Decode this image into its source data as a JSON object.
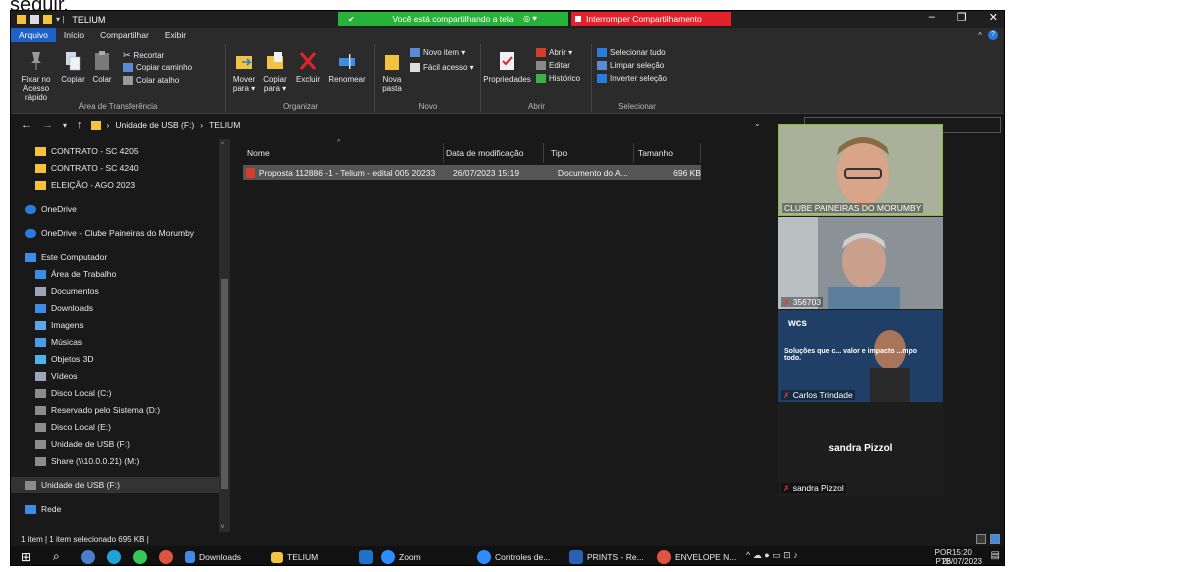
{
  "doc_fragment": "seguir.",
  "window": {
    "title": "TELIUM",
    "share_banner": "Você está compartilhando a tela",
    "stop_share": "Interromper Compartilhamento"
  },
  "ribbon_tabs": [
    {
      "label": "Arquivo",
      "active": true
    },
    {
      "label": "Início",
      "active": false
    },
    {
      "label": "Compartilhar",
      "active": false
    },
    {
      "label": "Exibir",
      "active": false
    }
  ],
  "ribbon": {
    "clipboard": {
      "label": "Área de Transferência",
      "pin_label": "Fixar no Acesso rápido",
      "copy_label": "Copiar",
      "paste_label": "Colar",
      "cut_label": "Recortar",
      "copy_path_label": "Copiar caminho",
      "paste_shortcut_label": "Colar atalho"
    },
    "organize": {
      "label": "Organizar",
      "move_label": "Mover para ▾",
      "copy_to_label": "Copiar para ▾",
      "delete_label": "Excluir",
      "rename_label": "Renomear"
    },
    "new": {
      "label": "Novo",
      "new_folder_label": "Nova pasta",
      "new_item_label": "Novo item ▾",
      "easy_access_label": "Fácil acesso ▾"
    },
    "open": {
      "label": "Abrir",
      "properties_label": "Propriedades",
      "open_label": "Abrir ▾",
      "edit_label": "Editar",
      "history_label": "Histórico"
    },
    "select": {
      "label": "Selecionar",
      "select_all_label": "Selecionar tudo",
      "clear_selection_label": "Limpar seleção",
      "invert_selection_label": "Inverter seleção"
    }
  },
  "address": {
    "crumbs": [
      "Unidade de USB (F:)",
      "TELIUM"
    ],
    "separator": "›"
  },
  "nav_items": [
    {
      "label": "CONTRATO - SC 4205",
      "icon": "folder-icon",
      "color": "#f3c33d"
    },
    {
      "label": "CONTRATO - SC 4240",
      "icon": "folder-icon",
      "color": "#f3c33d"
    },
    {
      "label": "ELEIÇÃO - AGO 2023",
      "icon": "folder-icon",
      "color": "#f3c33d"
    },
    {
      "label": "OneDrive",
      "icon": "cloud-icon",
      "color": "#2a7be0"
    },
    {
      "label": "OneDrive - Clube Paineiras do Morumby",
      "icon": "cloud-icon",
      "color": "#2a7be0"
    },
    {
      "label": "Este Computador",
      "icon": "computer-icon",
      "color": "#3d8de6"
    },
    {
      "label": "Área de Trabalho",
      "icon": "desktop-icon",
      "color": "#3d8de6"
    },
    {
      "label": "Documentos",
      "icon": "documents-icon",
      "color": "#9aa6b8"
    },
    {
      "label": "Downloads",
      "icon": "download-icon",
      "color": "#3d8de6"
    },
    {
      "label": "Imagens",
      "icon": "images-icon",
      "color": "#5ea7e6"
    },
    {
      "label": "Músicas",
      "icon": "music-icon",
      "color": "#4a9be8"
    },
    {
      "label": "Objetos 3D",
      "icon": "cube-icon",
      "color": "#4bb5e8"
    },
    {
      "label": "Vídeos",
      "icon": "video-icon",
      "color": "#9aa6b8"
    },
    {
      "label": "Disco Local (C:)",
      "icon": "drive-icon",
      "color": "#8c8c8c"
    },
    {
      "label": "Reservado pelo Sistema (D:)",
      "icon": "drive-icon",
      "color": "#8c8c8c"
    },
    {
      "label": "Disco Local (E:)",
      "icon": "drive-icon",
      "color": "#8c8c8c"
    },
    {
      "label": "Unidade de USB (F:)",
      "icon": "usb-drive-icon",
      "color": "#8c8c8c"
    },
    {
      "label": "Share (\\\\10.0.0.21) (M:)",
      "icon": "network-drive-icon",
      "color": "#8c8c8c"
    },
    {
      "label": "Unidade de USB (F:)",
      "icon": "usb-drive-icon",
      "color": "#8c8c8c",
      "selected": true
    },
    {
      "label": "Rede",
      "icon": "network-icon",
      "color": "#3d8de6"
    }
  ],
  "file_list": {
    "columns": [
      "Nome",
      "Data de modificação",
      "Tipo",
      "Tamanho"
    ],
    "rows": [
      {
        "name": "Proposta 112886 -1 - Telium - edital 005 20233",
        "modified": "26/07/2023 15:19",
        "type": "Documento do A...",
        "size": "696 KB"
      }
    ]
  },
  "status_bar": "1 item  |  1 item selecionado  695 KB  |",
  "participants": [
    {
      "name": "CLUBE PAINEIRAS DO MORUMBY",
      "muted": false,
      "bg": "#9aa58c"
    },
    {
      "name": "356703",
      "muted": true,
      "bg": "#7f8a93"
    },
    {
      "name": "Carlos Trindade",
      "muted": true,
      "bg": "#24476b",
      "overlay_logo": "wcs",
      "overlay_text": "Soluções que c... valor e impacto ...mpo todo."
    },
    {
      "name": "sandra Pizzol",
      "muted": true,
      "bg": "#1d1d1d",
      "center_label": "sandra Pizzol"
    }
  ],
  "taskbar": {
    "apps": [
      {
        "label": "Downloads",
        "icon": "download-icon",
        "color": "#3d8de6"
      },
      {
        "label": "TELIUM",
        "icon": "folder-icon",
        "color": "#f3c33d",
        "active": true
      },
      {
        "label": "Zoom",
        "icon": "zoom-icon",
        "color": "#2d8cff"
      },
      {
        "label": "Controles de...",
        "icon": "zoom-icon",
        "color": "#2d8cff"
      },
      {
        "label": "PRINTS - Re...",
        "icon": "word-icon",
        "color": "#2b5fb3"
      },
      {
        "label": "ENVELOPE N...",
        "icon": "chrome-icon",
        "color": "#e0533f"
      }
    ],
    "tray": {
      "lang": "POR",
      "lang2": "PTB",
      "time": "15:20",
      "date": "26/07/2023"
    }
  }
}
